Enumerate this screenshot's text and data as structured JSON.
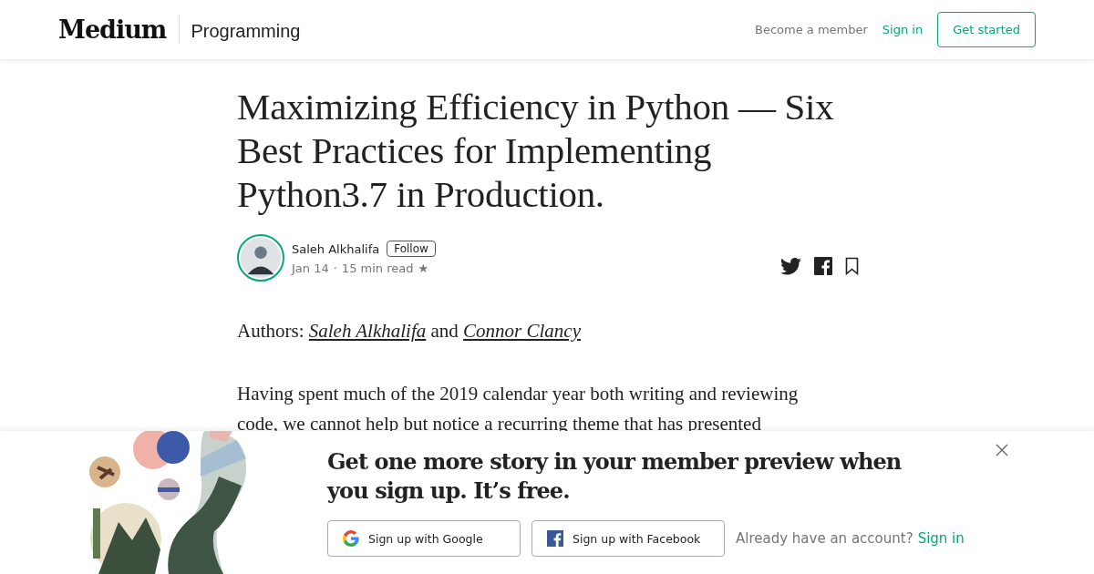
{
  "header": {
    "logo": "Medium",
    "section": "Programming",
    "links": [
      {
        "label": "Become a member",
        "kind": "muted"
      },
      {
        "label": "Sign in",
        "kind": "accent"
      }
    ],
    "cta": "Get started"
  },
  "article": {
    "title": "Maximizing Efficiency in Python — Six Best Practices for Implementing Python3.7 in Production.",
    "author": {
      "name": "Saleh Alkhalifa",
      "follow": "Follow",
      "date": "Jan 14",
      "separator": "·",
      "read_time": "15 min read",
      "star": "★"
    },
    "authors_line": {
      "label": "Authors:",
      "names": [
        "Saleh Alkhalifa",
        "Connor Clancy"
      ],
      "joiner": "and"
    },
    "paragraph": "Having spent much of the 2019 calendar year both writing and reviewing code, we cannot help but notice a recurring theme that has presented"
  },
  "banner": {
    "heading": "Get one more story in your member preview when you sign up. It’s free.",
    "buttons": [
      {
        "label": "Sign up with Google",
        "kind": "google"
      },
      {
        "label": "Sign up with Facebook",
        "kind": "facebook"
      }
    ],
    "question": "Already have an account?",
    "sign_in": "Sign in"
  }
}
